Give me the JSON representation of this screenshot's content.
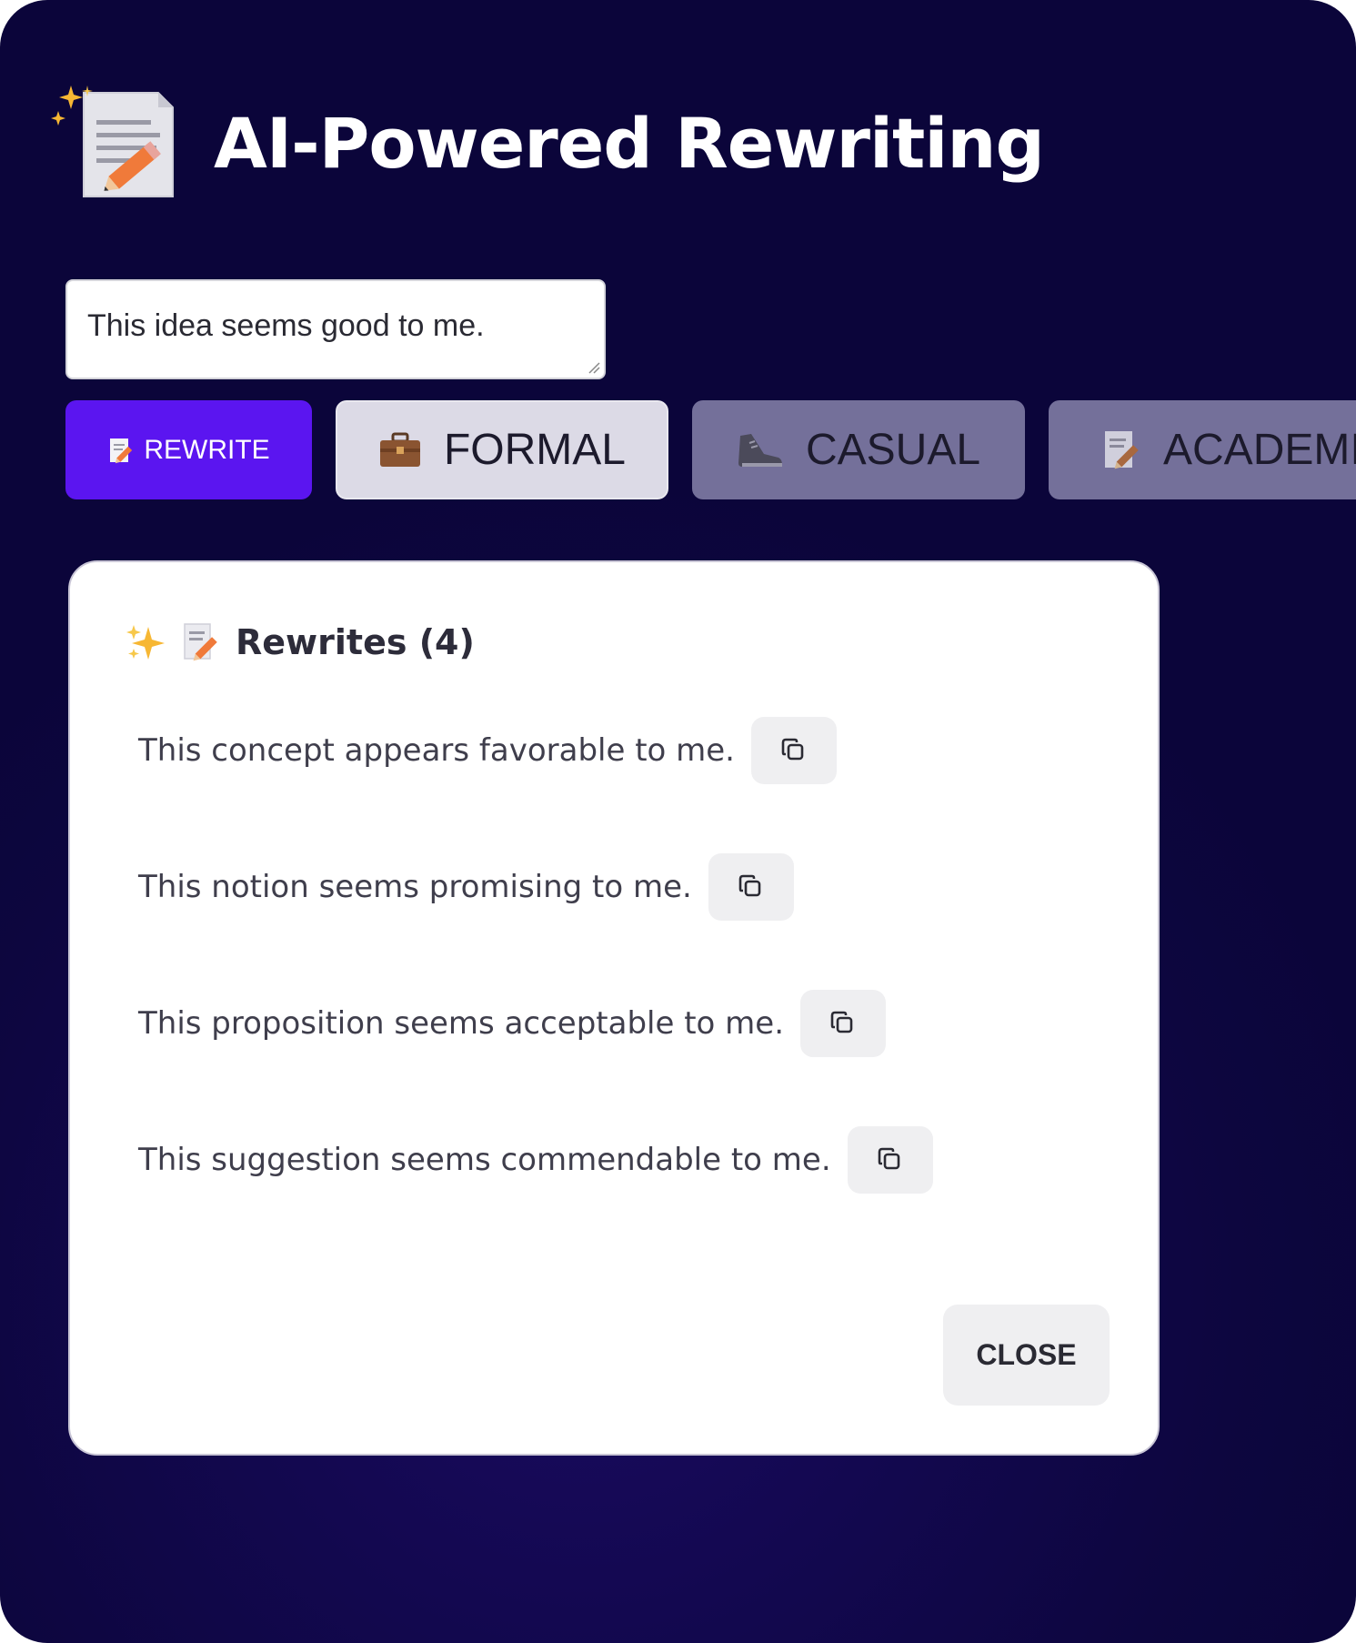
{
  "header": {
    "icon": "sparkle-document-pencil-icon",
    "title": "AI-Powered Rewriting"
  },
  "input": {
    "value": "This idea seems good to me."
  },
  "tone_buttons": [
    {
      "label": "REWRITE",
      "icon": "memo-pencil-icon",
      "state": "active"
    },
    {
      "label": "FORMAL",
      "icon": "briefcase-icon",
      "state": "selected"
    },
    {
      "label": "CASUAL",
      "icon": "sneaker-icon",
      "state": "inactive"
    },
    {
      "label": "ACADEMI",
      "icon": "memo-pencil-icon",
      "state": "inactive"
    }
  ],
  "results": {
    "title": "Rewrites (4)",
    "icons": [
      "sparkles-icon",
      "memo-pencil-icon"
    ],
    "items": [
      "This concept appears favorable to me.",
      "This notion seems promising to me.",
      "This proposition seems acceptable to me.",
      "This suggestion seems commendable to me."
    ],
    "close_label": "CLOSE"
  },
  "colors": {
    "background": "#0d063f",
    "rewrite_button": "#5b15f0",
    "formal_button": "#dcdae6",
    "inactive_button": "#74709a",
    "card": "#ffffff"
  }
}
